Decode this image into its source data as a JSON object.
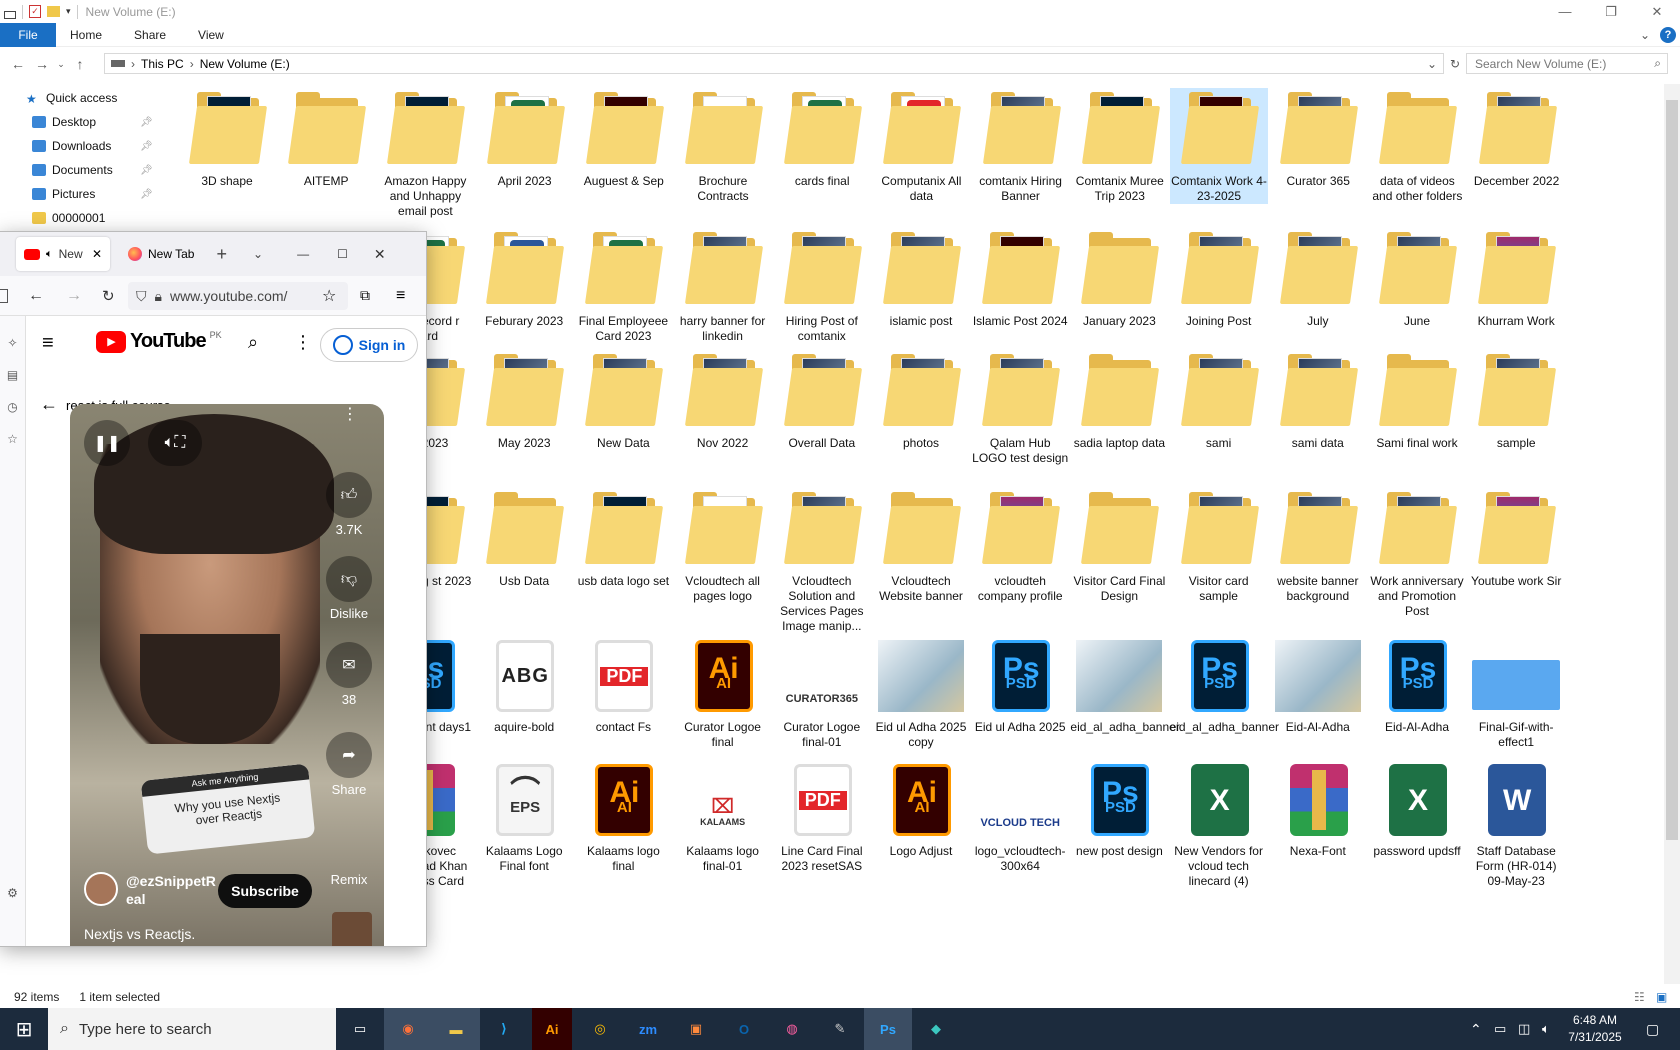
{
  "explorer": {
    "title": "New Volume (E:)",
    "ribbon_tabs": [
      "File",
      "Home",
      "Share",
      "View"
    ],
    "path": [
      "This PC",
      "New Volume (E:)"
    ],
    "search_placeholder": "Search New Volume (E:)",
    "nav": [
      {
        "label": "Quick access",
        "icon": "star-icon",
        "pinned": false
      },
      {
        "label": "Desktop",
        "icon": "desktop-icon",
        "pinned": true
      },
      {
        "label": "Downloads",
        "icon": "download-icon",
        "pinned": true
      },
      {
        "label": "Documents",
        "icon": "documents-icon",
        "pinned": true
      },
      {
        "label": "Pictures",
        "icon": "pictures-icon",
        "pinned": true
      },
      {
        "label": "00000001",
        "icon": "folder-icon",
        "pinned": false
      }
    ],
    "rows": [
      [
        "3D shape",
        "AITEMP",
        "Amazon Happy and Unhappy email post",
        "April 2023",
        "Auguest & Sep",
        "Brochure Contracts",
        "cards final",
        "Computanix All data",
        "comtanix Hiring Banner",
        "Comtanix Muree Trip 2023",
        "Comtanix Work 4-23-2025",
        "Curator 365",
        "data of videos and other folders",
        "December 2022"
      ],
      [
        "yee Record r Card",
        "Feburary 2023",
        "Final  Employeee Card 2023",
        "harry banner for linkedin",
        "Hiring Post of comtanix",
        "islamic post",
        "Islamic Post 2024",
        "January 2023",
        "Joining Post",
        "July",
        "June",
        "Khurram Work"
      ],
      [
        "rch 2023",
        "May 2023",
        "New Data",
        "Nov 2022",
        "Overall Data",
        "photos",
        "Qalam Hub LOGO test design",
        "sadia laptop data",
        "sami",
        "sami data",
        "Sami final work",
        "sample"
      ],
      [
        "nksgiving st 2023",
        "Usb Data",
        "usb data logo set",
        "Vcloudtech all pages logo",
        "Vcloudtech Solution and Services Pages Image manip...",
        "Vcloudtech Website banner",
        "vcloudteh company profile",
        "Visitor Card Final Design",
        "Visitor card sample",
        "website banner background",
        "Work anniversary and Promotion  Post",
        "Youtube work Sir"
      ],
      [
        "dependent days1",
        "aquire-bold",
        "contact Fs",
        "Curator Logoe final",
        "Curator Logoe final-01",
        "Eid ul Adha 2025 copy",
        "Eid ul Adha 2025",
        "eid_al_adha_banner",
        "eid_al_adha_banner",
        "Eid-Al-Adha",
        "Eid-Al-Adha",
        "Final-Gif-with-effect1"
      ],
      [
        "y Haskovec uhammad Khan Business Card",
        "Kalaams Logo Final font",
        "Kalaams logo final",
        "Kalaams logo final-01",
        "Line Card Final 2023 resetSAS",
        "Logo Adjust",
        "logo_vcloudtech-300x64",
        "new post design",
        "New Vendors for vcloud tech linecard (4)",
        "Nexa-Font",
        "password updsff",
        "Staff Database Form (HR-014) 09-May-23"
      ]
    ],
    "row_kinds": [
      [
        "folder-ps",
        "folder",
        "folder-ps",
        "folder-xl",
        "folder-ai",
        "folder-doc",
        "folder-xl",
        "folder-pdf",
        "folder-img",
        "folder-ps",
        "folder-ai",
        "folder-img",
        "folder",
        "folder-img"
      ],
      [
        "folder-xl",
        "folder-word",
        "folder-xl",
        "folder-img",
        "folder-img",
        "folder-img",
        "folder-ai",
        "folder",
        "folder-img",
        "folder-img",
        "folder-img",
        "folder-rar"
      ],
      [
        "folder-img",
        "folder-img",
        "folder-img",
        "folder-img",
        "folder-img",
        "folder-img",
        "folder-img",
        "folder",
        "folder-img",
        "folder-img",
        "folder",
        "folder-img"
      ],
      [
        "folder-ps",
        "folder",
        "folder-ps",
        "folder-doc",
        "folder-img",
        "folder",
        "folder-rar",
        "folder",
        "folder-img",
        "folder-img",
        "folder-img",
        "folder-rar"
      ],
      [
        "ps",
        "font",
        "pdf",
        "ai",
        "curator",
        "img",
        "ps",
        "img",
        "ps",
        "img",
        "ps",
        "gif"
      ],
      [
        "rar",
        "eps",
        "ai",
        "kalaams",
        "pdf",
        "ai",
        "vcloud",
        "ps",
        "xl",
        "rar",
        "xl",
        "word"
      ]
    ],
    "badge_text": {
      "ps": "Ps",
      "ai": "Ai",
      "pdf": "PDF",
      "xl": "X",
      "word": "W",
      "eps": "EPS",
      "font": "ABG",
      "psd": "PSD",
      "ai_sub": "AI",
      "curator": "CURATOR365",
      "kalaams": "KALAAMS",
      "vcloud": "VCLOUD TECH"
    },
    "selected": "Comtanix Work 4-23-2025",
    "status_count": "92 items",
    "status_selected": "1 item selected"
  },
  "browser": {
    "tab_active": "New",
    "tab_new": "New Tab",
    "url": "www.youtube.com/",
    "yt_region": "PK",
    "yt_brand": "YouTube",
    "sign_in": "Sign in",
    "query": "react js full course",
    "likes": "3.7K",
    "dislike": "Dislike",
    "comments": "38",
    "share": "Share",
    "remix": "Remix",
    "ask_header": "Ask me Anything",
    "ask_text": "Why you use Nextjs over Reactjs",
    "channel": "@ezSnippetReal",
    "channel_line1": "@ezSnippetR",
    "channel_line2": "eal",
    "subscribe": "Subscribe",
    "video_title": "Nextjs vs Reactjs."
  },
  "taskbar": {
    "search_placeholder": "Type here to search",
    "time": "6:48 AM",
    "date": "7/31/2025",
    "apps": [
      "task-view",
      "firefox",
      "file-explorer",
      "vscode",
      "illustrator",
      "chrome",
      "zoom",
      "app-orange",
      "outlook",
      "app-gradient",
      "pen-tool",
      "photoshop",
      "app-teal"
    ]
  },
  "colors": {
    "accent": "#1a6fc4",
    "folder": "#f7d774",
    "ps": "#001e36",
    "ps_border": "#31a8ff",
    "ai": "#330000",
    "ai_text": "#ff9a00",
    "pdf": "#e3262a",
    "xl": "#1e7145",
    "word": "#2b579a",
    "taskbar": "#1c2b3d"
  }
}
